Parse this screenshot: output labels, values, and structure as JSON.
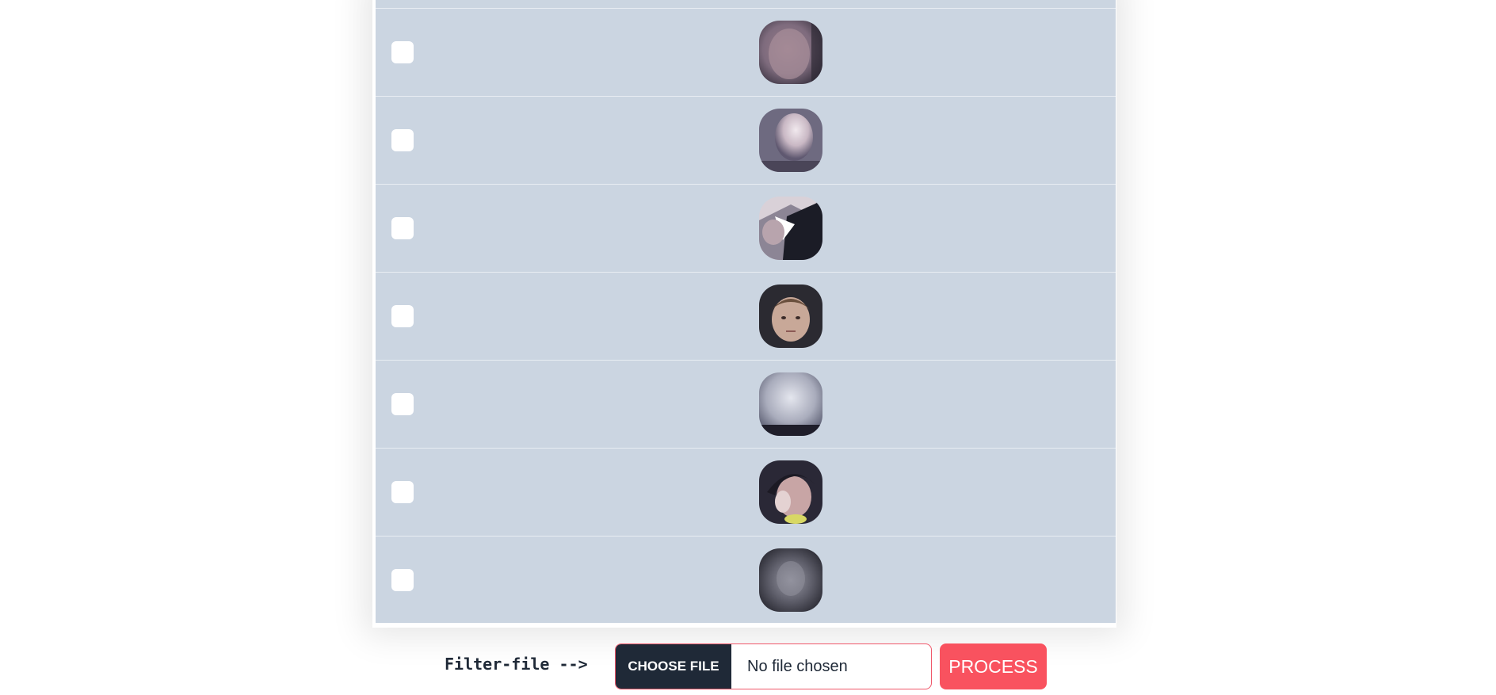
{
  "rows": [
    {
      "thumb_icon": "face-thumbnail-1"
    },
    {
      "thumb_icon": "face-thumbnail-2"
    },
    {
      "thumb_icon": "face-thumbnail-3"
    },
    {
      "thumb_icon": "face-thumbnail-4"
    },
    {
      "thumb_icon": "face-thumbnail-5"
    },
    {
      "thumb_icon": "face-thumbnail-6"
    },
    {
      "thumb_icon": "face-thumbnail-7"
    }
  ],
  "footer": {
    "filter_label": "Filter-file -->",
    "choose_file_label": "CHOOSE FILE",
    "file_status": "No file chosen",
    "process_label": "PROCESS"
  },
  "colors": {
    "table_bg": "#cbd5e1",
    "choose_btn_bg": "#1f2937",
    "process_btn_bg": "#f9525f",
    "file_input_border": "#f0576a"
  }
}
